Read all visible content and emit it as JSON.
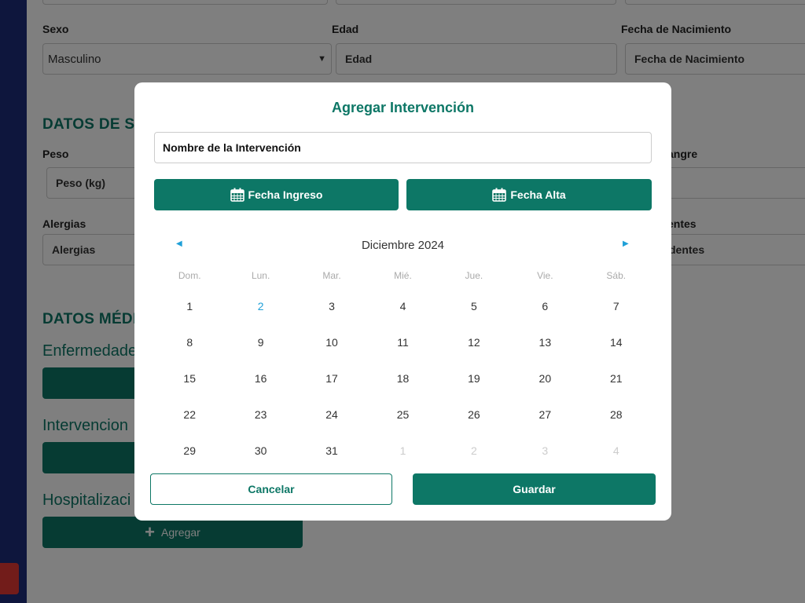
{
  "form": {
    "sexo_label": "Sexo",
    "sexo_value": "Masculino",
    "edad_label": "Edad",
    "edad_placeholder": "Edad",
    "nacimiento_label": "Fecha de Nacimiento",
    "nacimiento_placeholder": "Fecha de Nacimiento",
    "datos_salud_title": "DATOS DE SA",
    "peso_label": "Peso",
    "peso_placeholder": "Peso (kg)",
    "sangre_label": "angre",
    "alergias_label": "Alergias",
    "alergias_placeholder": "Alergias",
    "antecedentes_label": "entes",
    "antecedentes_placeholder": "dentes",
    "datos_medicos_title": "DATOS MÉDIC",
    "enfermedades_title": "Enfermedade",
    "intervenciones_title": "Intervencion",
    "hospitalizaciones_title": "Hospitalizaci",
    "agregar_label": "Agregar"
  },
  "modal": {
    "title": "Agregar Intervención",
    "name_input_placeholder": "Nombre de la Intervención",
    "fecha_ingreso_label": "Fecha Ingreso",
    "fecha_alta_label": "Fecha Alta",
    "month_label": "Diciembre 2024",
    "weekdays": [
      "Dom.",
      "Lun.",
      "Mar.",
      "Mié.",
      "Jue.",
      "Vie.",
      "Sáb."
    ],
    "weeks": [
      [
        "1",
        "2",
        "3",
        "4",
        "5",
        "6",
        "7"
      ],
      [
        "8",
        "9",
        "10",
        "11",
        "12",
        "13",
        "14"
      ],
      [
        "15",
        "16",
        "17",
        "18",
        "19",
        "20",
        "21"
      ],
      [
        "22",
        "23",
        "24",
        "25",
        "26",
        "27",
        "28"
      ],
      [
        "29",
        "30",
        "31",
        "1",
        "2",
        "3",
        "4"
      ]
    ],
    "highlighted_day": "2",
    "cancel_label": "Cancelar",
    "save_label": "Guardar"
  },
  "icons": {
    "prev": "caret-left-icon",
    "next": "caret-right-icon",
    "calendar": "calendar-icon",
    "plus": "plus-icon"
  },
  "colors": {
    "primary": "#0d7766",
    "sidebar": "#1d2c7a",
    "today": "#1fa0d8",
    "alert": "#e53935"
  }
}
